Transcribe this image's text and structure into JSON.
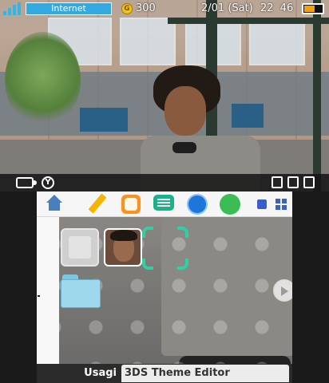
{
  "top_screen": {
    "status": {
      "network_label": "Internet",
      "coin_symbol": "G",
      "coin_count": "300",
      "date": "2/01 (Sat)",
      "time": "22 46",
      "battery_level_fraction": 0.6
    },
    "footer_icons": [
      "camera-icon",
      "y-button-icon",
      "top-right-icons"
    ]
  },
  "bottom_screen": {
    "toolbar_icons": [
      "home-settings-icon",
      "pencil-icon",
      "miiverse-smiley-icon",
      "notifications-chat-icon",
      "browser-globe-icon",
      "friend-list-icon",
      "small-view-icon",
      "grid-view-icon"
    ],
    "slots": [
      "empty-slot",
      "photo-slot",
      "selected-slot",
      "folder-slot"
    ],
    "footer": {
      "author": "Usagi",
      "theme_title": "3DS Theme Editor"
    }
  },
  "colors": {
    "accent_blue": "#33a9e0",
    "selector_green": "#2fd1a4",
    "bottom_bar": "#2b2b2b"
  }
}
